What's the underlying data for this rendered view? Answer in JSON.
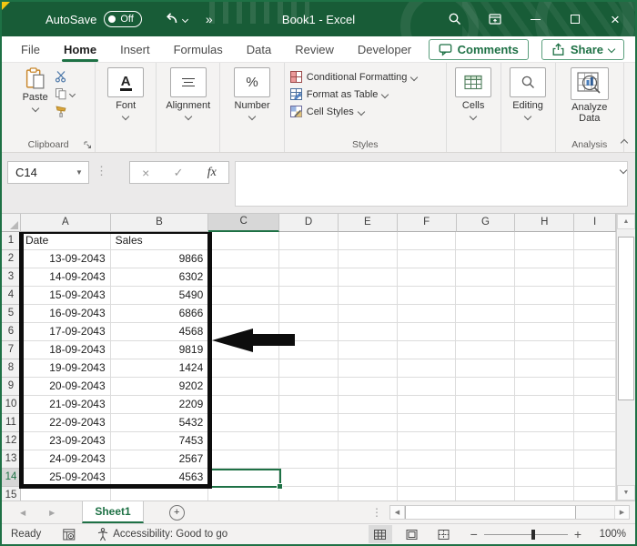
{
  "titlebar": {
    "autosave_label": "AutoSave",
    "autosave_state": "Off",
    "title": "Book1 - Excel"
  },
  "ribbon_tabs": {
    "items": [
      {
        "label": "File",
        "active": false
      },
      {
        "label": "Home",
        "active": true
      },
      {
        "label": "Insert",
        "active": false
      },
      {
        "label": "Formulas",
        "active": false
      },
      {
        "label": "Data",
        "active": false
      },
      {
        "label": "Review",
        "active": false
      },
      {
        "label": "Developer",
        "active": false
      }
    ],
    "comments_label": "Comments",
    "share_label": "Share"
  },
  "ribbon": {
    "clipboard": {
      "paste_label": "Paste",
      "group_label": "Clipboard"
    },
    "font_button": "Font",
    "alignment_button": "Alignment",
    "number_button": "Number",
    "styles": {
      "items": [
        "Conditional Formatting",
        "Format as Table",
        "Cell Styles"
      ],
      "group_label": "Styles"
    },
    "cells_button": "Cells",
    "editing_button": "Editing",
    "analysis": {
      "button_label": "Analyze Data",
      "group_label": "Analysis"
    }
  },
  "formula_bar": {
    "name_box_value": "C14",
    "fx_label": "fx",
    "formula_value": ""
  },
  "grid": {
    "column_headers": [
      "A",
      "B",
      "C",
      "D",
      "E",
      "F",
      "G",
      "H",
      "I"
    ],
    "visible_rows": 15,
    "selected_cell": "C14",
    "selected_column": "C",
    "selected_row": 14,
    "rows": [
      [
        "Date",
        "Sales"
      ],
      [
        "13-09-2043",
        "9866"
      ],
      [
        "14-09-2043",
        "6302"
      ],
      [
        "15-09-2043",
        "5490"
      ],
      [
        "16-09-2043",
        "6866"
      ],
      [
        "17-09-2043",
        "4568"
      ],
      [
        "18-09-2043",
        "9819"
      ],
      [
        "19-09-2043",
        "1424"
      ],
      [
        "20-09-2043",
        "9202"
      ],
      [
        "21-09-2043",
        "2209"
      ],
      [
        "22-09-2043",
        "5432"
      ],
      [
        "23-09-2043",
        "7453"
      ],
      [
        "24-09-2043",
        "2567"
      ],
      [
        "25-09-2043",
        "4563"
      ]
    ],
    "annotations": {
      "black_border_range": "A1:B14",
      "arrow": "black left-pointing arrow at rows 6-7 beside column B"
    }
  },
  "sheet_bar": {
    "tabs": [
      {
        "label": "Sheet1",
        "active": true
      }
    ]
  },
  "status_bar": {
    "ready_label": "Ready",
    "accessibility_status": "Accessibility: Good to go",
    "zoom_level": "100%"
  },
  "colors": {
    "titlebar_green": "#185c37",
    "accent_green": "#1e7145",
    "annotation_black": "#0d0d0d"
  }
}
